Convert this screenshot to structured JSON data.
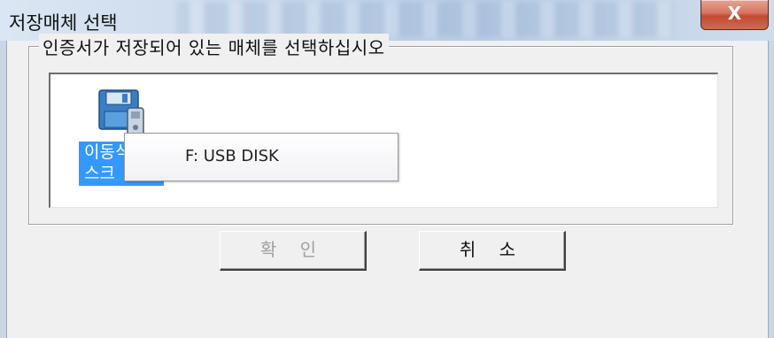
{
  "window": {
    "title": "저장매체 선택",
    "close_label": "X"
  },
  "group": {
    "legend": "인증서가 저장되어 있는 매체를 선택하십시오"
  },
  "list": {
    "items": [
      {
        "label": "이동식 디스크",
        "icon": "removable-disk-icon",
        "selected": true
      }
    ]
  },
  "tooltip": {
    "text": "F: USB DISK"
  },
  "buttons": {
    "ok": "확 인",
    "cancel": "취 소",
    "ok_enabled": false
  },
  "colors": {
    "selection": "#3399ff",
    "close": "#c24a33"
  }
}
